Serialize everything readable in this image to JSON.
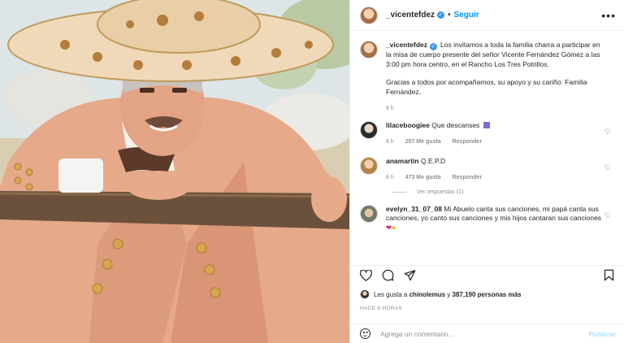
{
  "post": {
    "username": "_vicentefdez",
    "follow_label": "Seguir",
    "more_label": "•••",
    "separator": "•"
  },
  "caption": {
    "username": "_vicentefdez",
    "text_1": "Los invitamos a toda la familia charra a participar en la misa de cuerpo presente del señor Vicente Fernández Gómez a las 3:00 pm hora centro, en el Rancho Los Tres Potrillos.",
    "text_2": "Gracias a todos por acompañarnos, su apoyo y su cariño. Familia Fernández.",
    "time": "8 h"
  },
  "comments": [
    {
      "username": "lilaceboogiee",
      "text": "Que descanses",
      "time": "8 h",
      "likes": "257 Me gusta",
      "reply": "Responder"
    },
    {
      "username": "anamartin",
      "text": "Q.E.P.D",
      "time": "8 h",
      "likes": "473 Me gusta",
      "reply": "Responder",
      "view_replies": "Ver respuestas (1)"
    },
    {
      "username": "evelyn_31_07_08",
      "text": "Mi Abuelo canta sus canciones, mi papá canta sus canciones, yo canto sus canciones y mis hijos cantaran sus canciones"
    }
  ],
  "likes": {
    "prefix": "Les gusta a",
    "user": "chinolemus",
    "connector": "y",
    "count": "387,190 personas más"
  },
  "posted_ago": "HACE 8 HORAS",
  "add_comment": {
    "placeholder": "Agrega un comentario...",
    "publish_label": "Publicar"
  },
  "icons": [
    "verified-icon",
    "more-options-icon",
    "like-icon",
    "comment-icon",
    "share-icon",
    "save-icon",
    "emoji-icon"
  ],
  "colors": {
    "link_blue": "#0095f6",
    "verified": "#3897f0",
    "muted": "#8e8e8e"
  }
}
